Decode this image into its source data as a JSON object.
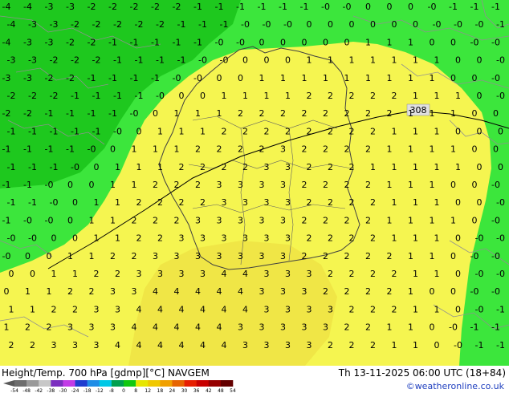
{
  "footer": {
    "title": "Height/Temp. 700 hPa [gdmp][°C] NAVGEM",
    "datetime": "Th 13-11-2025 06:00 UTC (18+84)",
    "credit": "©weatheronline.co.uk"
  },
  "contour_label": "308",
  "colorbar": {
    "ticks": [
      "-54",
      "-48",
      "-42",
      "-38",
      "-30",
      "-24",
      "-18",
      "-12",
      "-8",
      "0",
      "8",
      "12",
      "18",
      "24",
      "30",
      "36",
      "42",
      "48",
      "54"
    ],
    "colors": [
      "#6e6e6e",
      "#9a9a9a",
      "#c8c8c8",
      "#7b2fbf",
      "#c23be6",
      "#1e3ccf",
      "#1f8de6",
      "#00c8e6",
      "#00a050",
      "#10c810",
      "#e6e600",
      "#f0c800",
      "#f0a000",
      "#e66400",
      "#e61e00",
      "#c80000",
      "#960000",
      "#640000"
    ]
  },
  "palette": {
    "green_dark": "#1ec81e",
    "green_light": "#3ce63c",
    "yellow": "#f5f550",
    "yellow_warm": "#f0e646",
    "border": "#808080",
    "country_border": "#404040",
    "contour": "#000000"
  },
  "grid_values": [
    {
      "r": 0,
      "v": [
        "-4",
        "-4",
        "-3",
        "-3",
        "-2",
        "-2",
        "-2",
        "-2",
        "-2",
        "-1",
        "-1",
        "-1",
        "-1",
        "-1",
        "-1",
        "-0",
        "-0",
        "0",
        "0",
        "0",
        "-0",
        "-1",
        "-1",
        "-1"
      ]
    },
    {
      "r": 1,
      "v": [
        "-4",
        "-3",
        "-3",
        "-2",
        "-2",
        "-2",
        "-2",
        "-2",
        "-1",
        "-1",
        "-1",
        "-0",
        "-0",
        "-0",
        "0",
        "0",
        "0",
        "0",
        "0",
        "0",
        "-0",
        "-0",
        "-0",
        "-1"
      ]
    },
    {
      "r": 2,
      "v": [
        "-4",
        "-3",
        "-3",
        "-2",
        "-2",
        "-1",
        "-1",
        "-1",
        "-1",
        "-1",
        "-0",
        "-0",
        "0",
        "0",
        "0",
        "0",
        "0",
        "1",
        "1",
        "1",
        "0",
        "0",
        "-0",
        "-0"
      ]
    },
    {
      "r": 3,
      "v": [
        "-3",
        "-3",
        "-2",
        "-2",
        "-2",
        "-1",
        "-1",
        "-1",
        "-1",
        "-0",
        "-0",
        "0",
        "0",
        "0",
        "1",
        "1",
        "1",
        "1",
        "1",
        "1",
        "1",
        "0",
        "0",
        "-0"
      ]
    },
    {
      "r": 4,
      "v": [
        "-3",
        "-3",
        "-2",
        "-2",
        "-1",
        "-1",
        "-1",
        "-1",
        "-0",
        "-0",
        "0",
        "0",
        "1",
        "1",
        "1",
        "1",
        "1",
        "1",
        "1",
        "1",
        "1",
        "0",
        "0",
        "-0"
      ]
    },
    {
      "r": 5,
      "v": [
        "-2",
        "-2",
        "-2",
        "-1",
        "-1",
        "-1",
        "-1",
        "-0",
        "0",
        "0",
        "1",
        "1",
        "1",
        "1",
        "2",
        "2",
        "2",
        "2",
        "2",
        "1",
        "1",
        "1",
        "0",
        "-0"
      ]
    },
    {
      "r": 6,
      "v": [
        "-2",
        "-2",
        "-1",
        "-1",
        "-1",
        "-1",
        "-0",
        "0",
        "1",
        "1",
        "1",
        "2",
        "2",
        "2",
        "2",
        "2",
        "2",
        "2",
        "2",
        "1",
        "1",
        "1",
        "0",
        "0"
      ]
    },
    {
      "r": 7,
      "v": [
        "-1",
        "-1",
        "-1",
        "-1",
        "-1",
        "-0",
        "0",
        "1",
        "1",
        "1",
        "2",
        "2",
        "2",
        "2",
        "2",
        "2",
        "2",
        "2",
        "1",
        "1",
        "1",
        "0",
        "0",
        "0"
      ]
    },
    {
      "r": 8,
      "v": [
        "-1",
        "-1",
        "-1",
        "-1",
        "-0",
        "0",
        "1",
        "1",
        "1",
        "2",
        "2",
        "2",
        "2",
        "3",
        "2",
        "2",
        "2",
        "2",
        "1",
        "1",
        "1",
        "1",
        "0",
        "0"
      ]
    },
    {
      "r": 9,
      "v": [
        "-1",
        "-1",
        "-1",
        "-0",
        "0",
        "1",
        "1",
        "1",
        "2",
        "2",
        "2",
        "2",
        "3",
        "3",
        "2",
        "2",
        "2",
        "1",
        "1",
        "1",
        "1",
        "1",
        "0",
        "0"
      ]
    },
    {
      "r": 10,
      "v": [
        "-1",
        "-1",
        "-0",
        "0",
        "0",
        "1",
        "1",
        "2",
        "2",
        "2",
        "3",
        "3",
        "3",
        "3",
        "2",
        "2",
        "2",
        "2",
        "1",
        "1",
        "1",
        "0",
        "0",
        "-0"
      ]
    },
    {
      "r": 11,
      "v": [
        "-1",
        "-1",
        "-0",
        "0",
        "1",
        "1",
        "2",
        "2",
        "2",
        "2",
        "3",
        "3",
        "3",
        "3",
        "2",
        "2",
        "2",
        "2",
        "1",
        "1",
        "1",
        "0",
        "0",
        "-0"
      ]
    },
    {
      "r": 12,
      "v": [
        "-1",
        "-0",
        "-0",
        "0",
        "1",
        "1",
        "2",
        "2",
        "2",
        "3",
        "3",
        "3",
        "3",
        "3",
        "2",
        "2",
        "2",
        "2",
        "1",
        "1",
        "1",
        "1",
        "0",
        "-0"
      ]
    },
    {
      "r": 13,
      "v": [
        "-0",
        "-0",
        "0",
        "0",
        "1",
        "1",
        "2",
        "2",
        "3",
        "3",
        "3",
        "3",
        "3",
        "3",
        "2",
        "2",
        "2",
        "2",
        "1",
        "1",
        "1",
        "0",
        "-0",
        "-0"
      ]
    },
    {
      "r": 14,
      "v": [
        "-0",
        "0",
        "0",
        "1",
        "1",
        "2",
        "2",
        "3",
        "3",
        "3",
        "3",
        "3",
        "3",
        "3",
        "2",
        "2",
        "2",
        "2",
        "2",
        "1",
        "1",
        "0",
        "-0",
        "-0"
      ]
    },
    {
      "r": 15,
      "v": [
        "0",
        "0",
        "1",
        "1",
        "2",
        "2",
        "3",
        "3",
        "3",
        "3",
        "4",
        "4",
        "3",
        "3",
        "3",
        "2",
        "2",
        "2",
        "2",
        "1",
        "1",
        "0",
        "-0",
        "-0"
      ]
    },
    {
      "r": 16,
      "v": [
        "0",
        "1",
        "1",
        "2",
        "2",
        "3",
        "3",
        "4",
        "4",
        "4",
        "4",
        "4",
        "3",
        "3",
        "3",
        "2",
        "2",
        "2",
        "2",
        "1",
        "0",
        "0",
        "-0",
        "-0"
      ]
    },
    {
      "r": 17,
      "v": [
        "1",
        "1",
        "2",
        "2",
        "3",
        "3",
        "4",
        "4",
        "4",
        "4",
        "4",
        "4",
        "3",
        "3",
        "3",
        "3",
        "2",
        "2",
        "2",
        "1",
        "1",
        "0",
        "-0",
        "-1"
      ]
    },
    {
      "r": 18,
      "v": [
        "1",
        "2",
        "2",
        "3",
        "3",
        "3",
        "4",
        "4",
        "4",
        "4",
        "4",
        "3",
        "3",
        "3",
        "3",
        "3",
        "2",
        "2",
        "1",
        "1",
        "0",
        "-0",
        "-1",
        "-1"
      ]
    },
    {
      "r": 19,
      "v": [
        "2",
        "2",
        "3",
        "3",
        "3",
        "4",
        "4",
        "4",
        "4",
        "4",
        "4",
        "3",
        "3",
        "3",
        "3",
        "2",
        "2",
        "2",
        "1",
        "1",
        "0",
        "-0",
        "-1",
        "-1"
      ]
    }
  ]
}
